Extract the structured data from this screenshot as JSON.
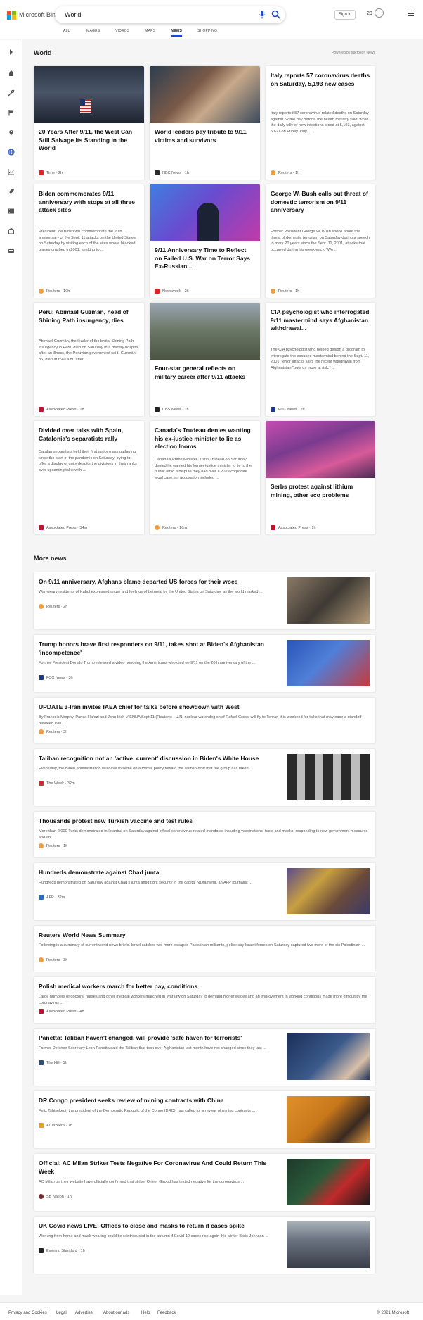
{
  "header": {
    "brand": "Microsoft Bing",
    "brand_colors": [
      "#f25022",
      "#7fba00",
      "#00a4ef",
      "#ffb900"
    ],
    "search_value": "World",
    "signin_label": "Sign in",
    "rewards_count": "20",
    "accent": "#174ae4",
    "tabs": [
      {
        "label": "ALL"
      },
      {
        "label": "IMAGES"
      },
      {
        "label": "VIDEOS"
      },
      {
        "label": "MAPS"
      },
      {
        "label": "NEWS",
        "active": true
      },
      {
        "label": "SHOPPING"
      }
    ]
  },
  "sidebar": {
    "icons": [
      "chevron-right-icon",
      "home-icon",
      "tools-icon",
      "flag-icon",
      "location-pin-icon",
      "globe-icon",
      "chart-icon",
      "rocket-icon",
      "film-icon",
      "building-icon",
      "car-icon"
    ]
  },
  "main": {
    "section_title": "World",
    "powered_by": "Powered by Microsoft News",
    "cards": [
      {
        "title": "20 Years After 9/11, the West Can Still Salvage Its Standing in the World",
        "snippet": "",
        "source": "Time",
        "time": "2h",
        "logo_color": "#e02424"
      },
      {
        "title": "World leaders pay tribute to 9/11 victims and survivors",
        "snippet": "",
        "source": "NBC News",
        "time": "1h",
        "logo_color": "#2b2b2b"
      },
      {
        "title": "Italy reports 57 coronavirus deaths on Saturday, 5,193 new cases",
        "snippet": "Italy reported 57 coronavirus-related deaths on Saturday against 62 the day before, the health ministry said, while the daily tally of new infections stood at 5,193, against 5,621 on Friday. Italy ...",
        "source": "Reuters",
        "time": "1h",
        "logo_color": "#f39a3a"
      },
      {
        "title": "Biden commemorates 9/11 anniversary with stops at all three attack sites",
        "snippet": "President Joe Biden will commemorate the 20th anniversary of the Sept. 11 attacks on the United States on Saturday by visiting each of the sites where hijacked planes crashed in 2001, seeking to ...",
        "source": "Reuters",
        "time": "10h",
        "logo_color": "#f39a3a"
      },
      {
        "title": "9/11 Anniversary Time to Reflect on Failed U.S. War on Terror Says Ex-Russian...",
        "snippet": "",
        "source": "Newsweek",
        "time": "2h",
        "logo_color": "#e02424"
      },
      {
        "title": "George W. Bush calls out threat of domestic terrorism on 9/11 anniversary",
        "snippet": "Former President George W. Bush spoke about the threat of domestic terrorism on Saturday during a speech to mark 20 years since the Sept. 11, 2001, attacks that occurred during his presidency. \"We ...",
        "source": "Reuters",
        "time": "1h",
        "logo_color": "#f39a3a"
      },
      {
        "title": "Peru: Abimael Guzmán, head of Shining Path insurgency, dies",
        "snippet": "Abimael Guzmán, the leader of the brutal Shining Path insurgency in Peru, died on Saturday in a military hospital after an illness, the Peruvian government said. Guzmán, 86, died at 6:40 a.m. after ...",
        "source": "Associated Press",
        "time": "1h",
        "logo_color": "#c8102e"
      },
      {
        "title": "Four-star general reflects on military career after 9/11 attacks",
        "snippet": "",
        "source": "CBS News",
        "time": "1h",
        "logo_color": "#222222"
      },
      {
        "title": "CIA psychologist who interrogated 9/11 mastermind says Afghanistan withdrawal...",
        "snippet": "The CIA psychologist who helped design a program to interrogate the accused mastermind behind the Sept. 11, 2001, terror attacks says the recent withdrawal from Afghanistan \"puts us more at risk.\" ...",
        "source": "FOX News",
        "time": "2h",
        "logo_color": "#1a3a8c"
      },
      {
        "title": "Divided over talks with Spain, Catalonia's separatists rally",
        "snippet": "Catalan separatists held their first major mass gathering since the start of the pandemic on Saturday, trying to offer a display of unity despite the divisions in their ranks over upcoming talks with ...",
        "source": "Associated Press",
        "time": "54m",
        "logo_color": "#c8102e"
      },
      {
        "title": "Canada's Trudeau denies wanting his ex-justice minister to lie as election looms",
        "snippet": "Canada's Prime Minister Justin Trudeau on Saturday denied he wanted his former justice minister to lie to the public amid a dispute they had over a 2019 corporate legal case, an accusation included ...",
        "source": "Reuters",
        "time": "16m",
        "logo_color": "#f39a3a"
      },
      {
        "title": "Serbs protest against lithium mining, other eco problems",
        "snippet": "",
        "source": "Associated Press",
        "time": "1h",
        "logo_color": "#c8102e"
      }
    ]
  },
  "more": {
    "title": "More news",
    "rows": [
      {
        "title": "On 9/11 anniversary, Afghans blame departed US forces for their woes",
        "snippet": "War-weary residents of Kabul expressed anger and feelings of betrayal by the United States on Saturday, as the world marked ...",
        "source": "Reuters",
        "time": "2h",
        "logo_color": "#f39a3a"
      },
      {
        "title": "Trump honors brave first responders on 9/11, takes shot at Biden's Afghanistan 'incompetence'",
        "snippet": "Former President Donald Trump released a video honoring the Americans who died on 9/11 on the 20th anniversary of the ...",
        "source": "FOX News",
        "time": "3h",
        "logo_color": "#1a3a8c"
      },
      {
        "title": "UPDATE 3-Iran invites IAEA chief for talks before showdown with West",
        "snippet": "By Francois Murphy, Parisa Hafezi and John Irish VIENNA Sept 11 (Reuters) - U.N. nuclear watchdog chief Rafael Grossi will fly to Tehran this weekend for talks that may ease a standoff between Iran ...",
        "source": "Reuters",
        "time": "3h",
        "logo_color": "#f39a3a"
      },
      {
        "title": "Taliban recognition not an 'active, current' discussion in Biden's White House",
        "snippet": "Eventually, the Biden administration will have to settle on a formal policy toward the Taliban now that the group has taken ...",
        "source": "The Week",
        "time": "32m",
        "logo_color": "#d42a2a"
      },
      {
        "title": "Thousands protest new Turkish vaccine and test rules",
        "snippet": "More than 2,000 Turks demonstrated in Istanbul on Saturday against official coronavirus-related mandates including vaccinations, tests and masks, responding to new government measures and an ...",
        "source": "Reuters",
        "time": "1h",
        "logo_color": "#f39a3a"
      },
      {
        "title": "Hundreds demonstrate against Chad junta",
        "snippet": "Hundreds demonstrated on Saturday against Chad's junta amid tight security in the capital N'Djamena, an AFP journalist ...",
        "source": "AFP",
        "time": "32m",
        "logo_color": "#1f6fc4"
      },
      {
        "title": "Reuters World News Summary",
        "snippet": "Following is a summary of current world news briefs. Israel catches two more escaped Palestinian militants, police say Israeli forces on Saturday captured two more of the six Palestinian ...",
        "source": "Reuters",
        "time": "3h",
        "logo_color": "#f39a3a"
      },
      {
        "title": "Polish medical workers march for better pay, conditions",
        "snippet": "Large numbers of doctors, nurses and other medical workers marched in Warsaw on Saturday to demand higher wages and an improvement in working conditions made more difficult by the coronavirus ...",
        "source": "Associated Press",
        "time": "4h",
        "logo_color": "#c8102e"
      },
      {
        "title": "Panetta: Taliban haven't changed, will provide 'safe haven for terrorists'",
        "snippet": "Former Defense Secretary Leon Panetta said the Taliban that took over Afghanistan last month have not changed since they last ...",
        "source": "The Hill",
        "time": "1h",
        "logo_color": "#2b4f7a"
      },
      {
        "title": "DR Congo president seeks review of mining contracts with China",
        "snippet": "Felix Tshisekedi, the president of the Democratic Republic of the Congo (DRC), has called for a review of mining contracts ...",
        "source": "Al Jazeera",
        "time": "1h",
        "logo_color": "#e8a31d"
      },
      {
        "title": "Official: AC Milan Striker Tests Negative For Coronavirus And Could Return This Week",
        "snippet": "AC Milan on their website have officially confirmed that striker Olivier Giroud has tested negative for the coronavirus ...",
        "source": "SB Nation",
        "time": "1h",
        "logo_color": "#7a2b2b"
      },
      {
        "title": "UK Covid news LIVE: Offices to close and masks to return if cases spike",
        "snippet": "Working from home and mask-wearing could be reintroduced in the autumn if Covid-19 cases rise again this winter Boris Johnson ...",
        "source": "Evening Standard",
        "time": "1h",
        "logo_color": "#222222"
      }
    ]
  },
  "footer": {
    "links": [
      "Privacy and Cookies",
      "Legal",
      "Advertise",
      "About our ads",
      "Help",
      "Feedback"
    ],
    "copyright": "© 2021 Microsoft"
  }
}
